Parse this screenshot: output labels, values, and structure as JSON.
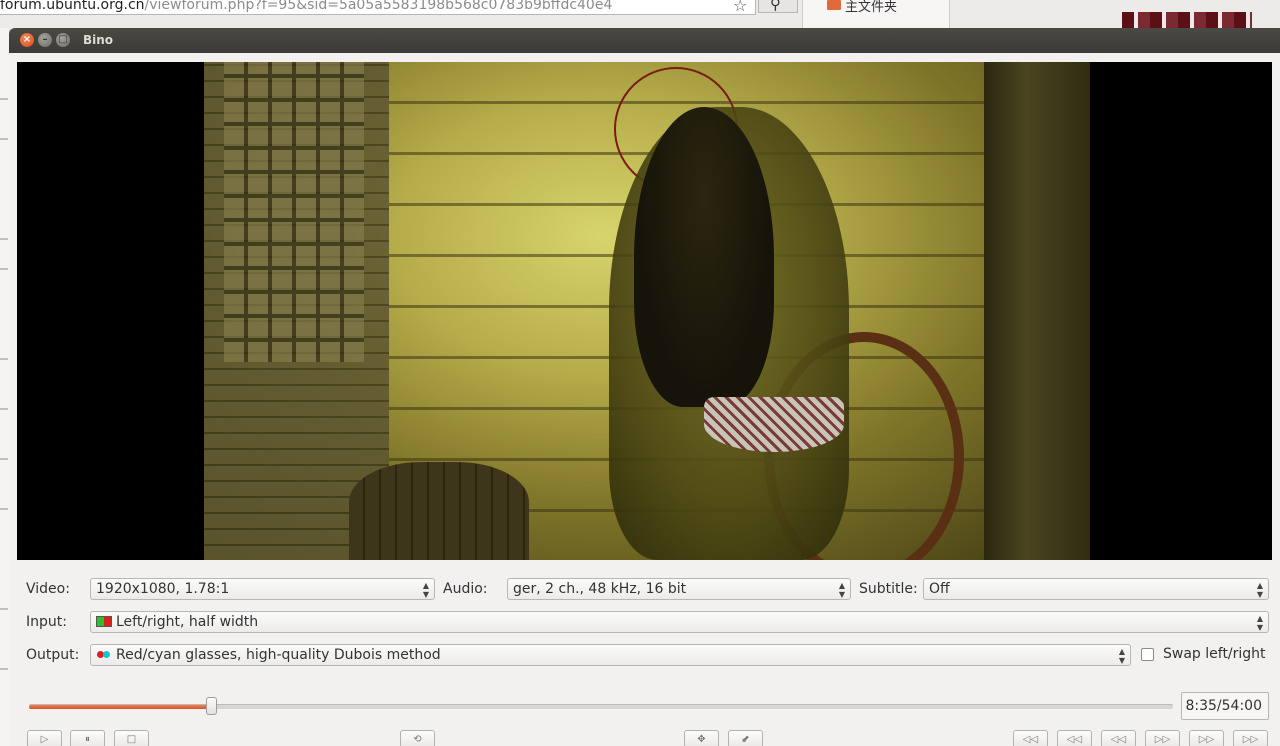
{
  "background": {
    "url_host": "forum.ubuntu.org.cn",
    "url_path": "/viewforum.php?f=95&sid=5a05a5583198b568c0783b9bffdc40e4",
    "side_panel_label": "主文件夹"
  },
  "window": {
    "title": "Bino",
    "close_glyph": "×",
    "min_glyph": "–",
    "max_glyph": "□"
  },
  "controls": {
    "video_label": "Video:",
    "video_value": "1920x1080, 1.78:1",
    "audio_label": "Audio:",
    "audio_value": "ger, 2 ch., 48 kHz, 16 bit",
    "subtitle_label": "Subtitle:",
    "subtitle_value": "Off",
    "input_label": "Input:",
    "input_value": "Left/right, half width",
    "output_label": "Output:",
    "output_value": "Red/cyan glasses, high-quality Dubois method",
    "swap_label": "Swap left/right",
    "swap_checked": false
  },
  "playback": {
    "time": "8:35/54:00",
    "progress_fraction": 0.159,
    "buttons": {
      "play": "▷",
      "pause": "⏸",
      "stop": "□",
      "loop": "⟲",
      "fullscreen": "✥",
      "zoom": "⬋",
      "seek_back_10m": "◁◁",
      "seek_back_1m": "◁◁",
      "seek_back_10s": "◁◁",
      "seek_fwd_10s": "▷▷",
      "seek_fwd_1m": "▷▷",
      "seek_fwd_10m": "▷▷"
    }
  },
  "colors": {
    "progress_fill": "#d9532a",
    "titlebar": "#3b3a36",
    "close_button": "#d9481a"
  }
}
